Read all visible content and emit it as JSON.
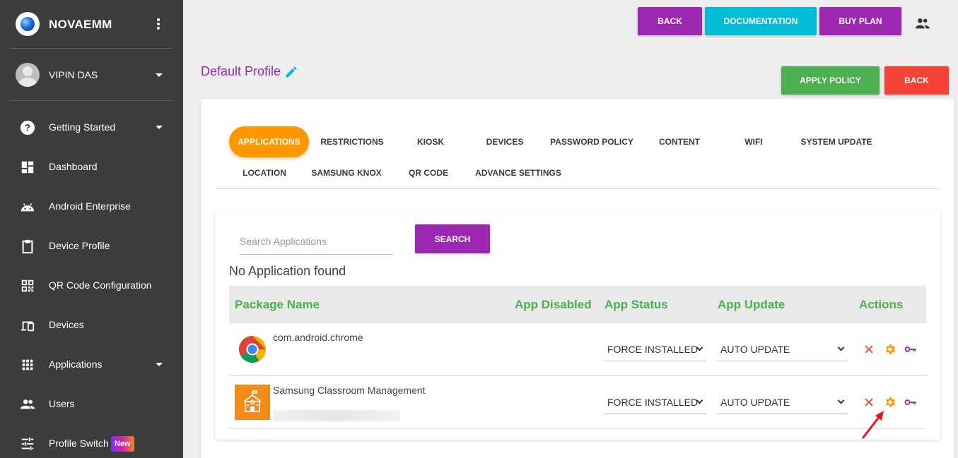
{
  "sidebar": {
    "brand": "NOVAEMM",
    "user": "VIPIN DAS",
    "items": [
      {
        "label": "Getting Started"
      },
      {
        "label": "Dashboard"
      },
      {
        "label": "Android Enterprise"
      },
      {
        "label": "Device Profile"
      },
      {
        "label": "QR Code Configuration"
      },
      {
        "label": "Devices"
      },
      {
        "label": "Applications"
      },
      {
        "label": "Users"
      },
      {
        "label": "Profile Switch",
        "badge": "New"
      }
    ]
  },
  "topbar": {
    "back_label": "BACK",
    "documentation_label": "DOCUMENTATION",
    "buy_plan_label": "BUY PLAN"
  },
  "profile": {
    "title": "Default Profile",
    "apply_label": "APPLY POLICY",
    "back_label": "BACK"
  },
  "tabs": [
    "APPLICATIONS",
    "RESTRICTIONS",
    "KIOSK",
    "DEVICES",
    "PASSWORD POLICY",
    "CONTENT",
    "WIFI",
    "SYSTEM UPDATE",
    "LOCATION",
    "SAMSUNG KNOX",
    "QR CODE",
    "ADVANCE SETTINGS"
  ],
  "active_tab": "APPLICATIONS",
  "search": {
    "placeholder": "Search Applications",
    "button_label": "SEARCH",
    "message": "No Application found"
  },
  "table": {
    "columns": [
      "Package Name",
      "App Disabled",
      "App Status",
      "App Update",
      "Actions"
    ],
    "rows": [
      {
        "package": "com.android.chrome",
        "status": "FORCE INSTALLED",
        "update": "AUTO UPDATE"
      },
      {
        "package": "Samsung Classroom Management",
        "status": "FORCE INSTALLED",
        "update": "AUTO UPDATE"
      }
    ]
  },
  "colors": {
    "sidebar": "#3c3c3c",
    "purple": "#9c27b0",
    "cyan": "#00bcd4",
    "green": "#4caf50",
    "red": "#f44336",
    "orange": "#ff9800"
  }
}
